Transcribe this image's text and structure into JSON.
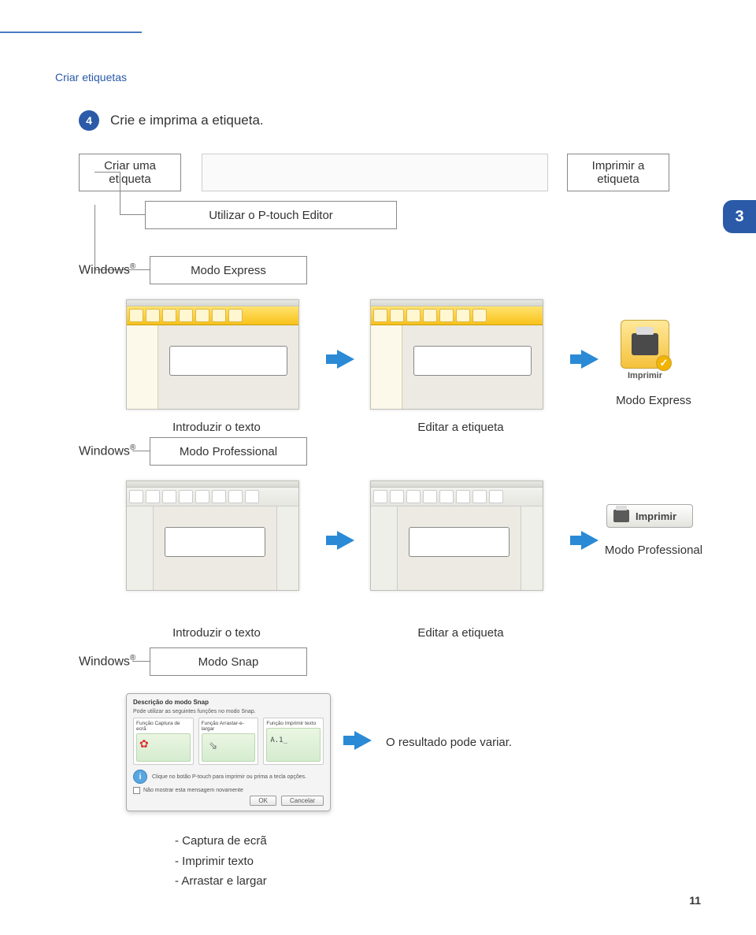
{
  "breadcrumb": "Criar etiquetas",
  "step": {
    "number": "4",
    "text": "Crie e imprima a etiqueta."
  },
  "boxes": {
    "criar": "Criar uma etiqueta",
    "imprimir": "Imprimir a etiqueta",
    "utilizar": "Utilizar o P-touch Editor",
    "modo_express": "Modo Express",
    "modo_professional": "Modo Professional",
    "modo_snap": "Modo Snap"
  },
  "chapter": "3",
  "os": {
    "label": "Windows",
    "reg": "®"
  },
  "imprimir_label": "Imprimir",
  "captions": {
    "introduzir": "Introduzir o texto",
    "editar": "Editar a etiqueta",
    "modo_express": "Modo Express",
    "modo_professional": "Modo Professional",
    "snap_result": "O resultado pode variar."
  },
  "snap_dialog": {
    "title": "Descrição do modo Snap",
    "subtitle": "Pode utilizar as seguintes funções no modo Snap.",
    "cards": [
      {
        "title": "Função Captura de ecrã"
      },
      {
        "title": "Função Arrastar-e-largar"
      },
      {
        "title": "Função Imprimir texto"
      }
    ],
    "tip": "Clique no botão P-touch para imprimir ou prima a tecla opções.",
    "checkbox": "Não mostrar esta mensagem novamente",
    "ok": "OK",
    "cancel": "Cancelar"
  },
  "snap_list": {
    "item1": "- Captura de ecrã",
    "item2": "- Imprimir texto",
    "item3": "- Arrastar e largar"
  },
  "page_number": "11"
}
